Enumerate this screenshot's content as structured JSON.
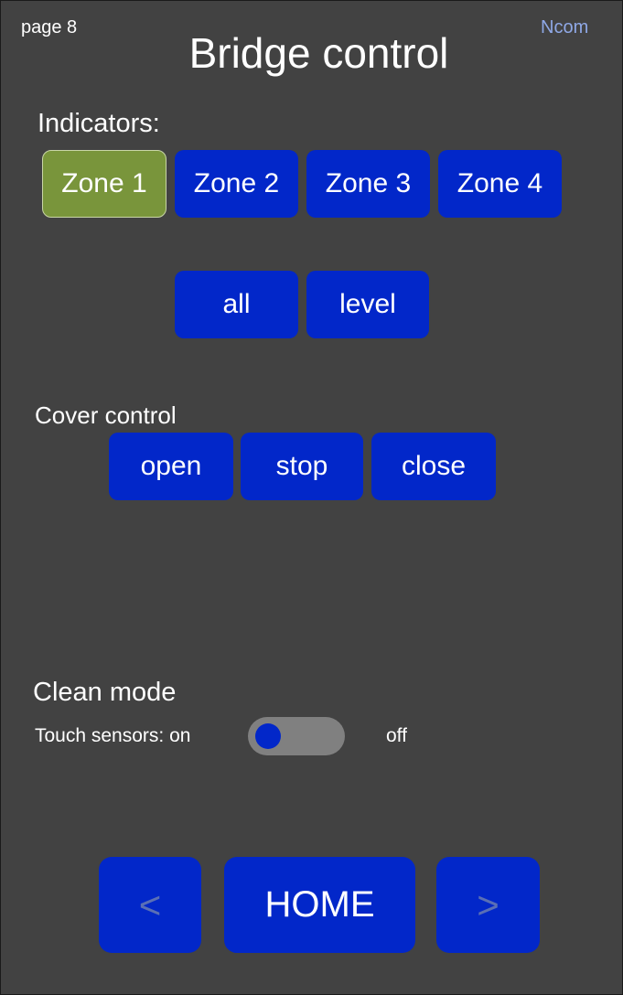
{
  "header": {
    "page_label": "page 8",
    "title": "Bridge control",
    "brand": "Ncom"
  },
  "indicators": {
    "heading": "Indicators:",
    "zones": [
      {
        "label": "Zone 1",
        "active": true
      },
      {
        "label": "Zone 2",
        "active": false
      },
      {
        "label": "Zone 3",
        "active": false
      },
      {
        "label": "Zone 4",
        "active": false
      }
    ],
    "all_label": "all",
    "level_label": "level"
  },
  "cover": {
    "heading": "Cover control",
    "open_label": "open",
    "stop_label": "stop",
    "close_label": "close"
  },
  "clean_mode": {
    "heading": "Clean mode",
    "touch_label": "Touch sensors: on",
    "off_label": "off",
    "toggle_state": "on"
  },
  "nav": {
    "prev_label": "<",
    "home_label": "HOME",
    "next_label": ">"
  },
  "colors": {
    "background": "#424242",
    "button_blue": "#0227c9",
    "active_green": "#79953b",
    "brand": "#8fa8e6",
    "toggle_track": "#808080"
  }
}
